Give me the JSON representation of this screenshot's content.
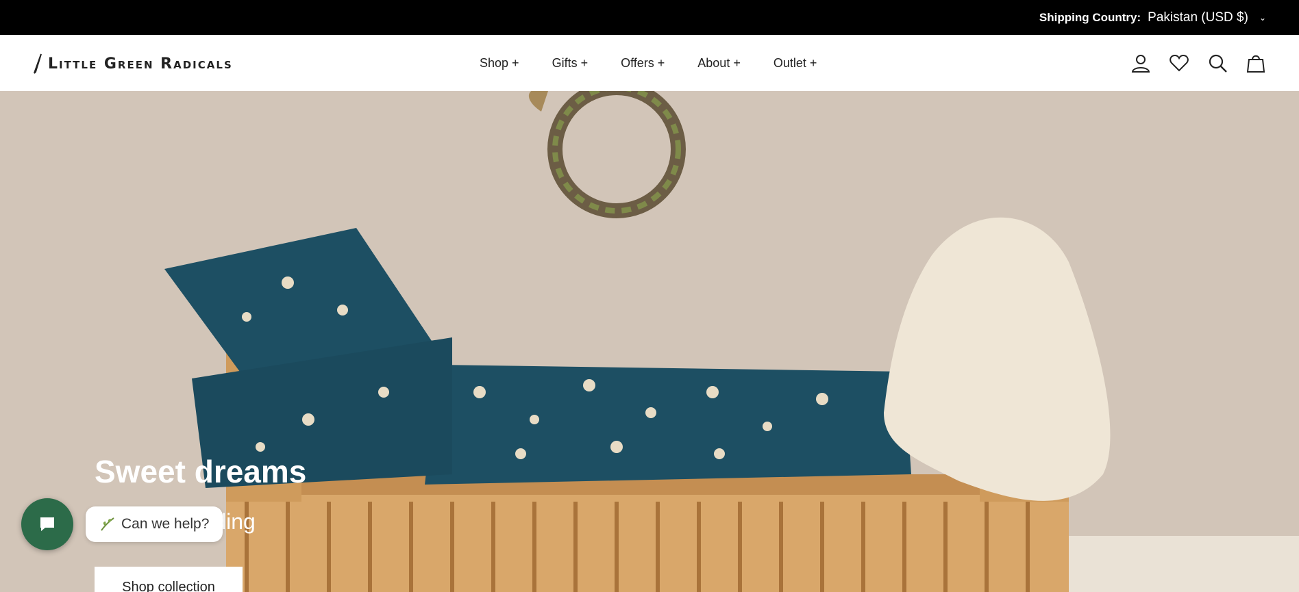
{
  "topbar": {
    "shipping_label": "Shipping Country:",
    "shipping_value": "Pakistan (USD $)"
  },
  "header": {
    "logo_text": "Little Green Radicals"
  },
  "nav": {
    "items": [
      "Shop +",
      "Gifts +",
      "Offers +",
      "About +",
      "Outlet +"
    ]
  },
  "icons": [
    "account-icon",
    "wishlist-icon",
    "search-icon",
    "cart-icon"
  ],
  "hero": {
    "title": "Sweet dreams",
    "subtitle": "Organic bedding",
    "cta": "Shop collection"
  },
  "chat": {
    "label": "Can we help?"
  },
  "colors": {
    "topbar": "#000000",
    "chat_button": "#2c6b49",
    "bedding": "#1d4f63"
  }
}
